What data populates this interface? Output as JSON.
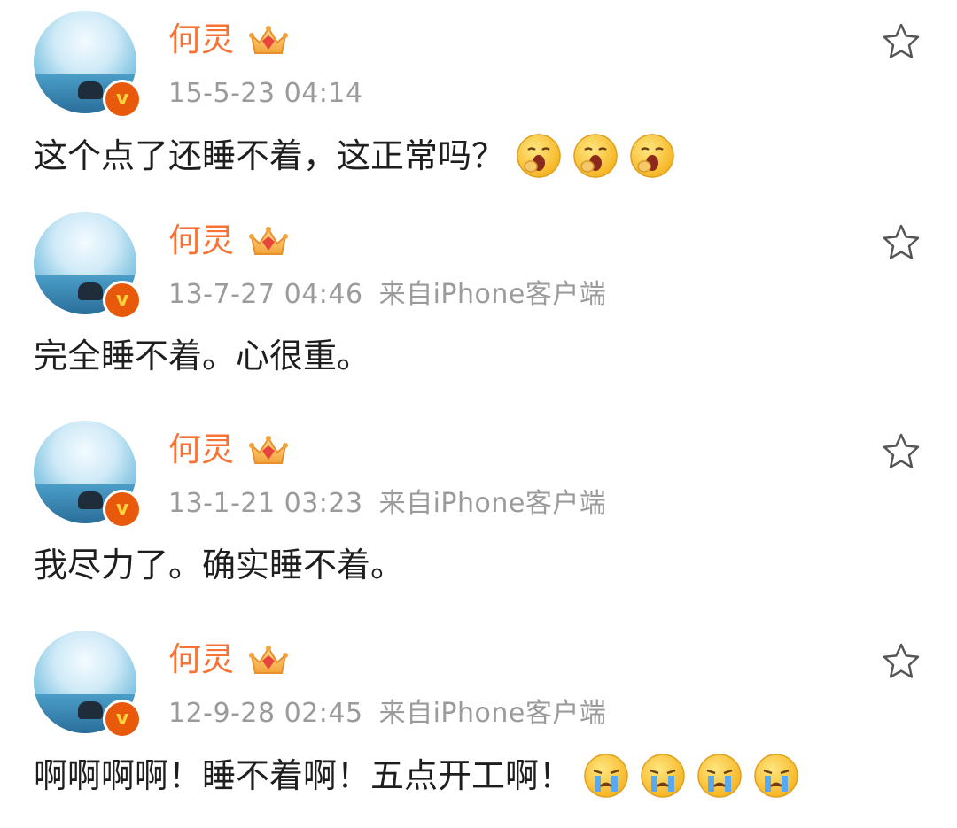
{
  "posts": [
    {
      "author": "何灵",
      "time": "15-5-23 04:14",
      "source": "",
      "text": "这个点了还睡不着，这正常吗？",
      "emojis": [
        "yawn-emoji",
        "yawn-emoji",
        "yawn-emoji"
      ]
    },
    {
      "author": "何灵",
      "time": "13-7-27 04:46",
      "source": "来自iPhone客户端",
      "text": "完全睡不着。心很重。",
      "emojis": []
    },
    {
      "author": "何灵",
      "time": "13-1-21 03:23",
      "source": "来自iPhone客户端",
      "text": "我尽力了。确实睡不着。",
      "emojis": []
    },
    {
      "author": "何灵",
      "time": "12-9-28 02:45",
      "source": "来自iPhone客户端",
      "text": "啊啊啊啊！睡不着啊！五点开工啊！",
      "emojis": [
        "crying-emoji",
        "crying-emoji",
        "crying-emoji",
        "crying-emoji"
      ]
    }
  ],
  "icons": {
    "verified": "verified-badge-icon",
    "member": "crown-icon",
    "favorite": "star-icon"
  },
  "colors": {
    "name": "#f77234",
    "meta": "#9b9b9b",
    "text": "#1e1e1e",
    "badge": "#e8590c"
  }
}
